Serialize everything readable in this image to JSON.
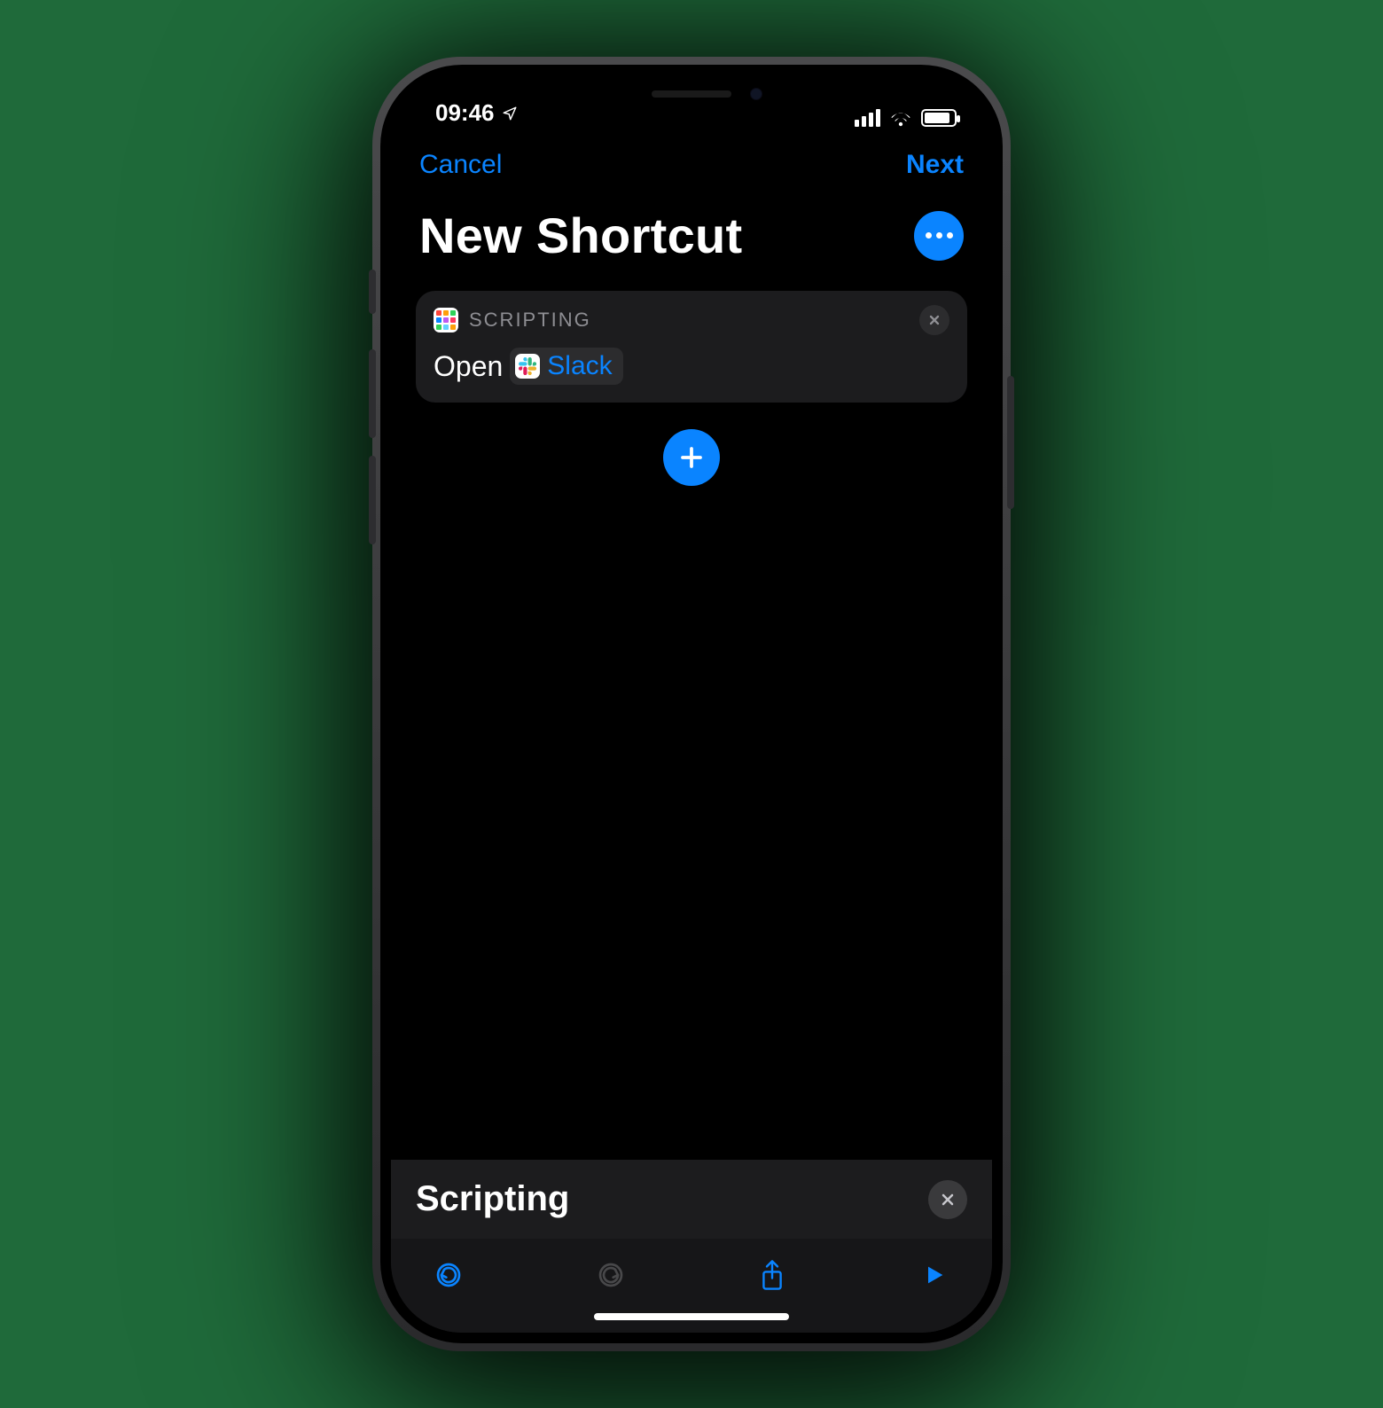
{
  "status": {
    "time": "09:46",
    "location_icon": "location-arrow",
    "cell_bars": 4,
    "wifi": true,
    "battery_percent": 80
  },
  "nav": {
    "cancel_label": "Cancel",
    "next_label": "Next"
  },
  "header": {
    "title": "New Shortcut",
    "more_icon": "ellipsis"
  },
  "action_card": {
    "category_icon": "app-grid",
    "category_label": "SCRIPTING",
    "verb": "Open",
    "app_name": "Slack",
    "app_icon": "slack",
    "close_icon": "xmark"
  },
  "add_action": {
    "icon": "plus"
  },
  "search_panel": {
    "text": "Scripting",
    "close_icon": "xmark"
  },
  "toolbar": {
    "undo_icon": "undo",
    "redo_icon": "redo",
    "share_icon": "share",
    "play_icon": "play"
  },
  "colors": {
    "accent": "#0a84ff",
    "card": "#1c1c1e",
    "gray_text": "#8e8e93"
  }
}
